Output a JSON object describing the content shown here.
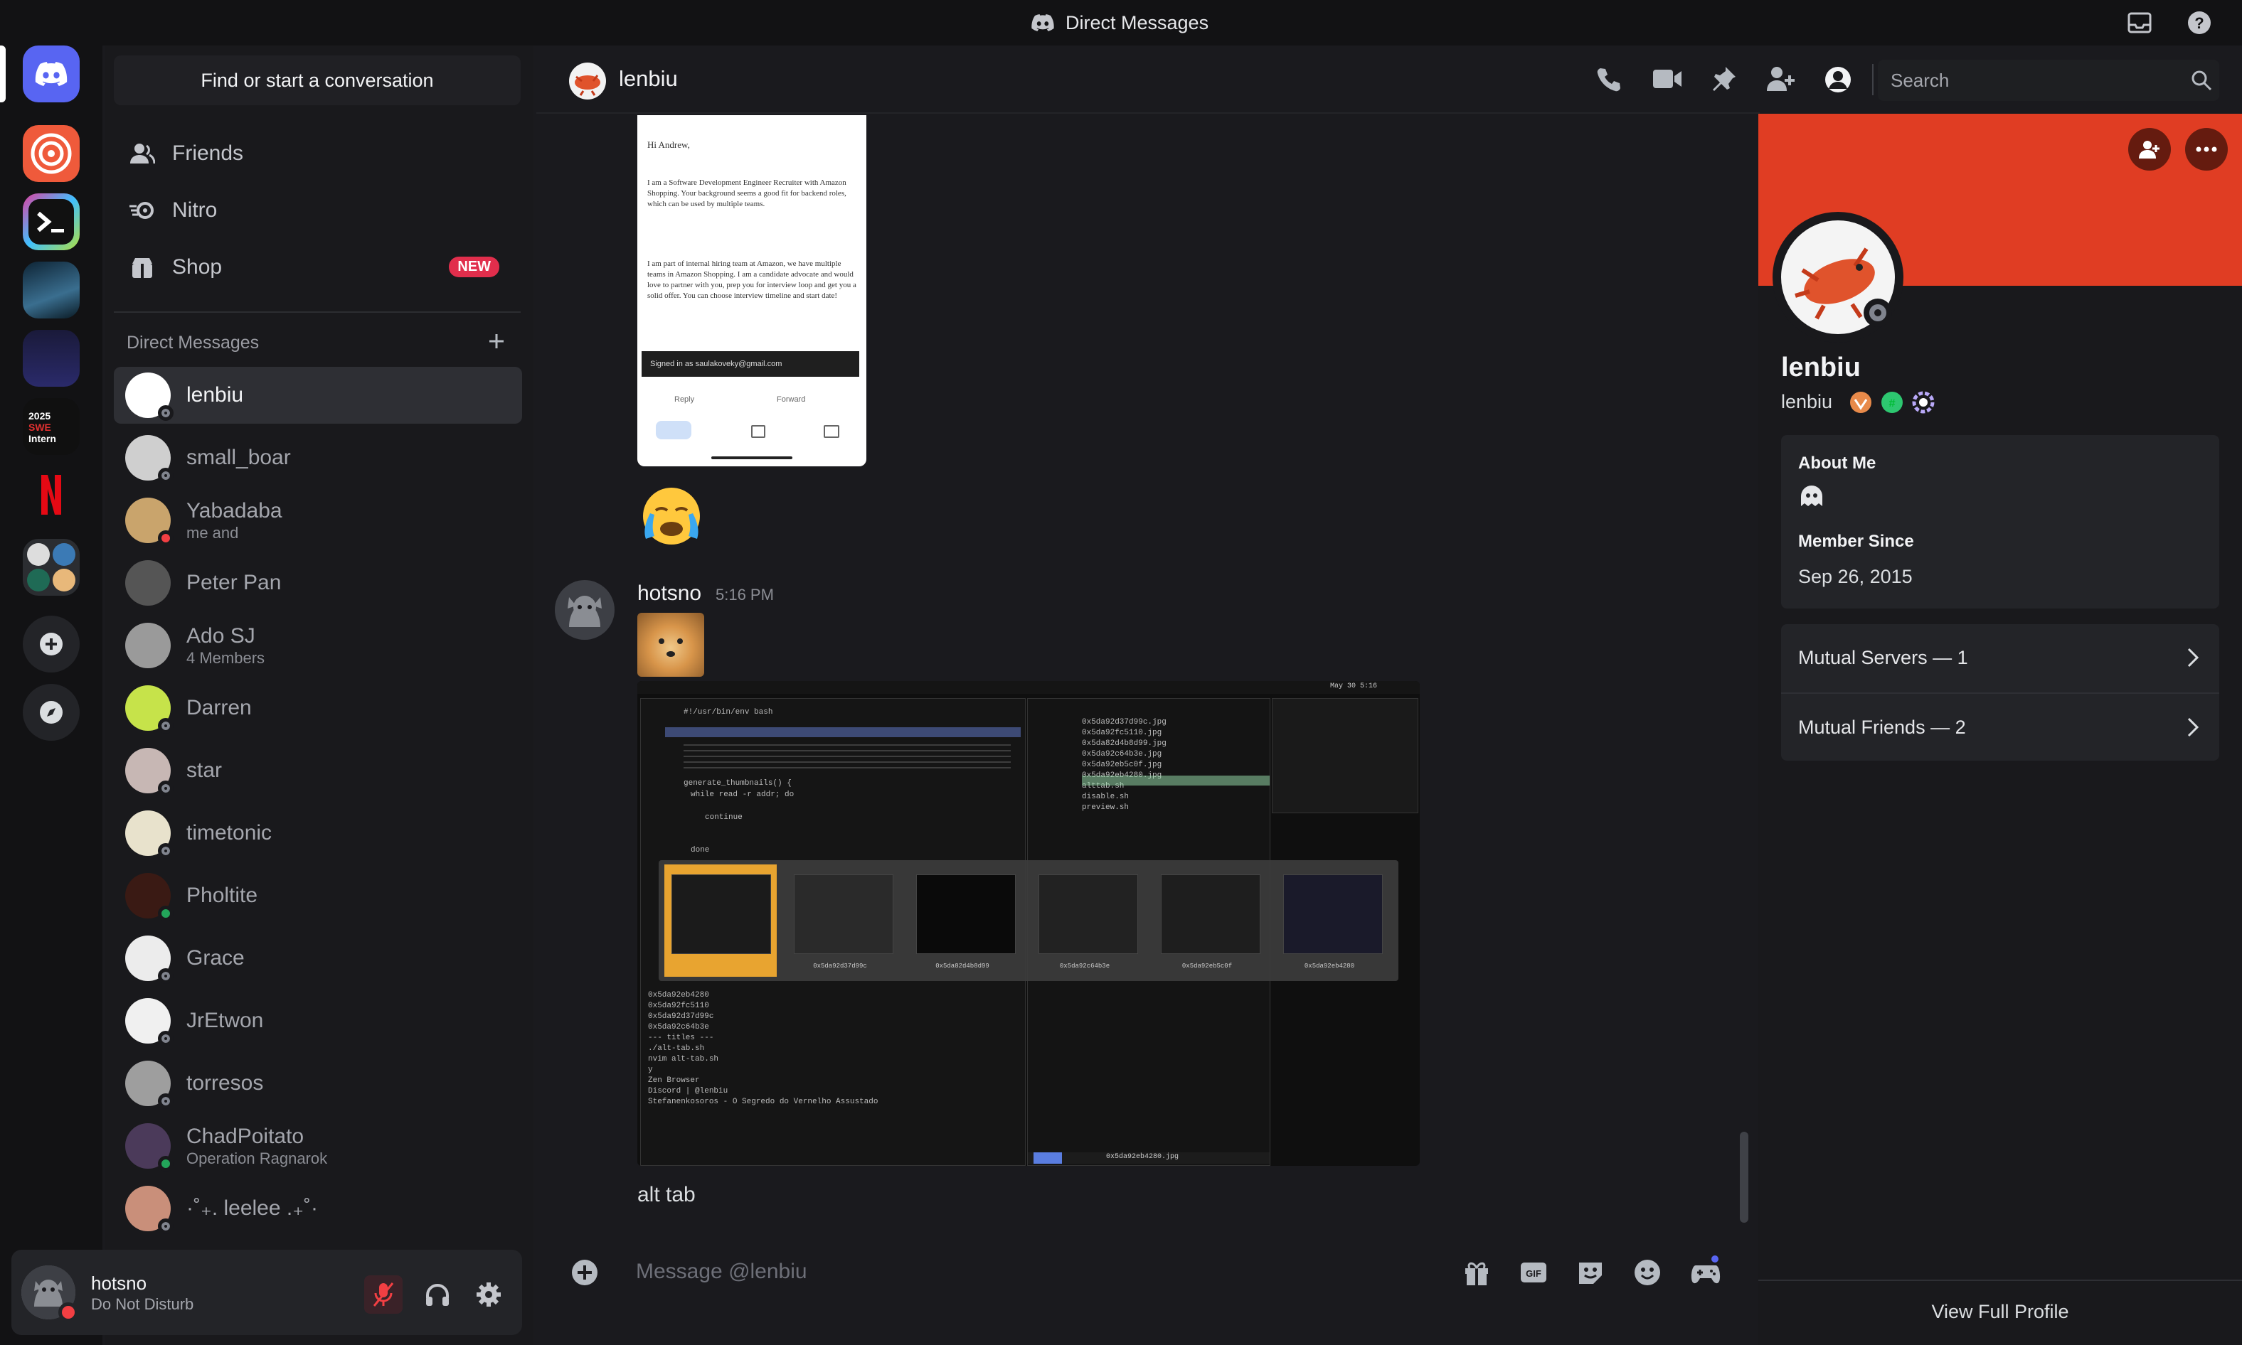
{
  "window": {
    "title": "Direct Messages"
  },
  "sidebar": {
    "search_label": "Find or start a conversation",
    "nav": [
      {
        "label": "Friends",
        "icon": "friends-icon"
      },
      {
        "label": "Nitro",
        "icon": "nitro-icon"
      },
      {
        "label": "Shop",
        "icon": "shop-icon",
        "badge": "NEW"
      }
    ],
    "dm_header": "Direct Messages",
    "dms": [
      {
        "name": "lenbiu",
        "status": "offline",
        "active": true,
        "color": "#ffffff"
      },
      {
        "name": "small_boar",
        "status": "offline",
        "color": "#cfcfcf"
      },
      {
        "name": "Yabadaba",
        "sub": "me and",
        "status": "dnd",
        "color": "#c9a46c"
      },
      {
        "name": "Peter Pan",
        "status": "none",
        "color": "#555"
      },
      {
        "name": "Ado SJ",
        "sub": "4 Members",
        "status": "none",
        "color": "#9a9a9a"
      },
      {
        "name": "Darren",
        "status": "offline",
        "color": "#c6e34a"
      },
      {
        "name": "star",
        "status": "offline",
        "color": "#c7b7b4"
      },
      {
        "name": "timetonic",
        "status": "offline",
        "color": "#e8e2cc"
      },
      {
        "name": "Pholtite",
        "status": "online",
        "color": "#3a1a14"
      },
      {
        "name": "Grace",
        "status": "offline",
        "color": "#ececec"
      },
      {
        "name": "JrEtwon",
        "status": "offline",
        "color": "#f0f0f0"
      },
      {
        "name": "torresos",
        "status": "offline",
        "color": "#9e9e9e"
      },
      {
        "name": "ChadPoitato",
        "sub": "Operation Ragnarok",
        "status": "online",
        "color": "#4b3a5a"
      },
      {
        "name": "·˚₊. leelee .₊˚·",
        "status": "offline",
        "color": "#c98f7a"
      }
    ],
    "user": {
      "name": "hotsno",
      "status": "Do Not Disturb"
    }
  },
  "chat": {
    "recipient": "lenbiu",
    "search_placeholder": "Search",
    "email_preview": {
      "greeting": "Hi Andrew,",
      "p1": "I am a Software Development Engineer Recruiter with Amazon Shopping. Your background seems a good fit for backend roles, which can be used by multiple teams.",
      "p2": "I am part of internal hiring team at Amazon, we have multiple teams in Amazon Shopping. I am a candidate advocate and would love to partner with you, prep you for interview loop and get you a solid offer. You can choose interview timeline and start date!",
      "signed": "Signed in as saulakoveky@gmail.com",
      "reply": "Reply",
      "forward": "Forward"
    },
    "message": {
      "author": "hotsno",
      "time": "5:16 PM",
      "text": "alt tab",
      "screenshot": {
        "status_time": "May 30 5:16",
        "files": [
          "0x5da92d37d99c.jpg",
          "0x5da92fc5110.jpg",
          "0x5da82d4b8d99.jpg",
          "0x5da92c64b3e.jpg",
          "0x5da92eb5c0f.jpg",
          "0x5da92eb4280.jpg",
          "alttab.sh",
          "disable.sh",
          "preview.sh"
        ],
        "bottom_file": "0x5da92eb4280.jpg",
        "thumb_labels": [
          "",
          "0x5da92d37d99c",
          "0x5da82d4b8d99",
          "0x5da92c64b3e",
          "0x5da92eb5c0f",
          "0x5da92eb4280"
        ],
        "code": [
          "#!/usr/bin/env bash",
          "generate_thumbnails() {",
          "while read -r addr; do",
          "continue",
          "done"
        ],
        "titles": [
          "0x5da92eb4280",
          "0x5da92fc5110",
          "0x5da92d37d99c",
          "0x5da92c64b3e",
          "--- titles ---",
          "./alt-tab.sh",
          "nvim alt-tab.sh",
          "y",
          "Zen Browser",
          "Discord | @lenbiu",
          "Stefanenkosoros - O Segredo do Vernelho Assustado"
        ]
      }
    },
    "composer_placeholder": "Message @lenbiu"
  },
  "profile": {
    "display_name": "lenbiu",
    "username": "lenbiu",
    "about_label": "About Me",
    "member_since_label": "Member Since",
    "member_since": "Sep 26, 2015",
    "mutual_servers": "Mutual Servers — 1",
    "mutual_friends": "Mutual Friends — 2",
    "view_full": "View Full Profile",
    "banner_color": "#e03d23"
  }
}
